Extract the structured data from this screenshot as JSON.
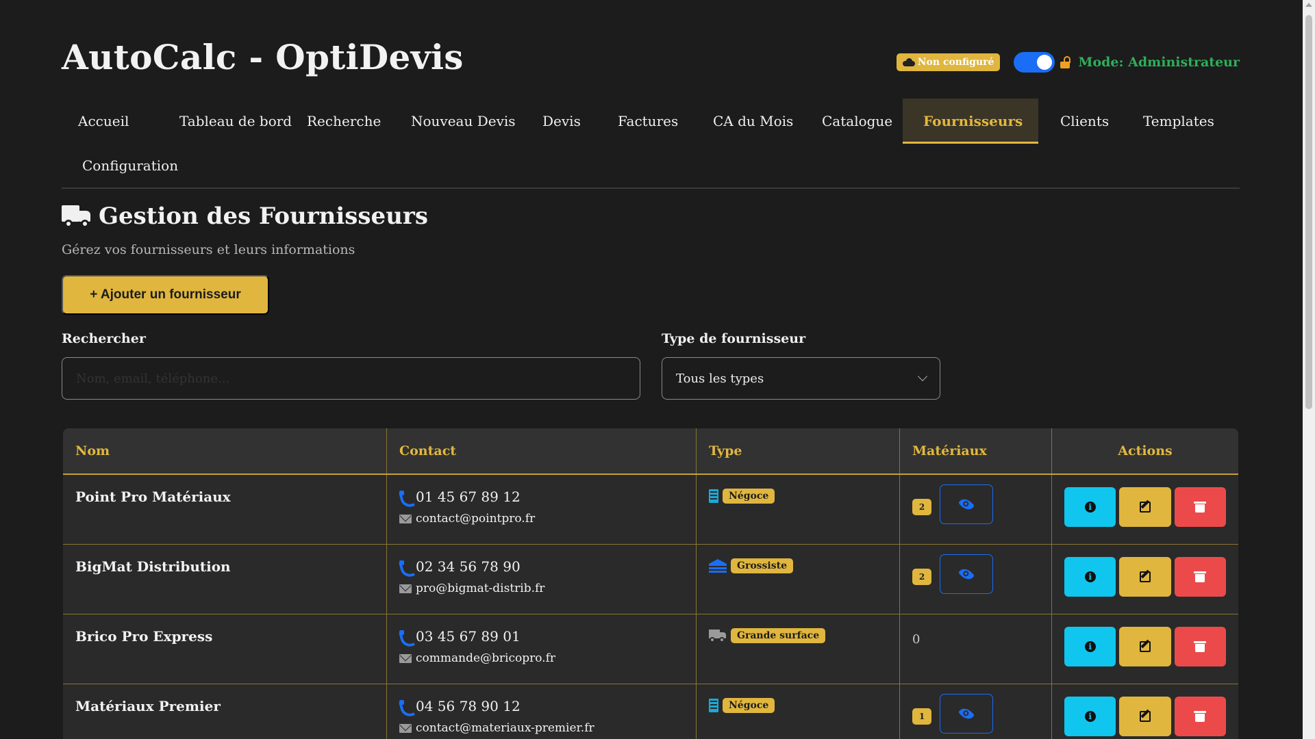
{
  "app": {
    "title": "AutoCalc - OptiDevis",
    "cloud_status": "Non configuré",
    "mode_label": "Mode: Administrateur",
    "admin_toggle_on": true
  },
  "nav": {
    "items": [
      {
        "label": "Accueil"
      },
      {
        "label": "Tableau de bord"
      },
      {
        "label": "Recherche"
      },
      {
        "label": "Nouveau Devis"
      },
      {
        "label": "Devis"
      },
      {
        "label": "Factures"
      },
      {
        "label": "CA du Mois"
      },
      {
        "label": "Catalogue"
      },
      {
        "label": "Fournisseurs",
        "active": true
      },
      {
        "label": "Clients"
      },
      {
        "label": "Templates"
      },
      {
        "label": "Configuration"
      }
    ]
  },
  "page": {
    "title": "Gestion des Fournisseurs",
    "subtitle": "Gérez vos fournisseurs et leurs informations",
    "add_button": "+ Ajouter un fournisseur"
  },
  "filters": {
    "search_label": "Rechercher",
    "search_placeholder": "Nom, email, téléphone...",
    "search_value": "",
    "type_label": "Type de fournisseur",
    "type_selected": "Tous les types"
  },
  "table": {
    "headers": [
      "Nom",
      "Contact",
      "Type",
      "Matériaux",
      "Actions"
    ],
    "rows": [
      {
        "name": "Point Pro Matériaux",
        "phone": "01 45 67 89 12",
        "email": "contact@pointpro.fr",
        "type": "Négoce",
        "type_icon": "building-icon",
        "materials": "2"
      },
      {
        "name": "BigMat Distribution",
        "phone": "02 34 56 78 90",
        "email": "pro@bigmat-distrib.fr",
        "type": "Grossiste",
        "type_icon": "warehouse-icon",
        "materials": "2"
      },
      {
        "name": "Brico Pro Express",
        "phone": "03 45 67 89 01",
        "email": "commande@bricopro.fr",
        "type": "Grande surface",
        "type_icon": "truck-icon",
        "materials": "0"
      },
      {
        "name": "Matériaux Premier",
        "phone": "04 56 78 90 12",
        "email": "contact@materiaux-premier.fr",
        "type": "Négoce",
        "type_icon": "building-icon",
        "materials": "1"
      }
    ]
  },
  "colors": {
    "accent": "#e0b63e",
    "primary": "#1a6ef5",
    "info": "#10c6ee",
    "danger": "#ec4a4a",
    "success": "#2fae5b",
    "background": "#1c1c1c"
  }
}
